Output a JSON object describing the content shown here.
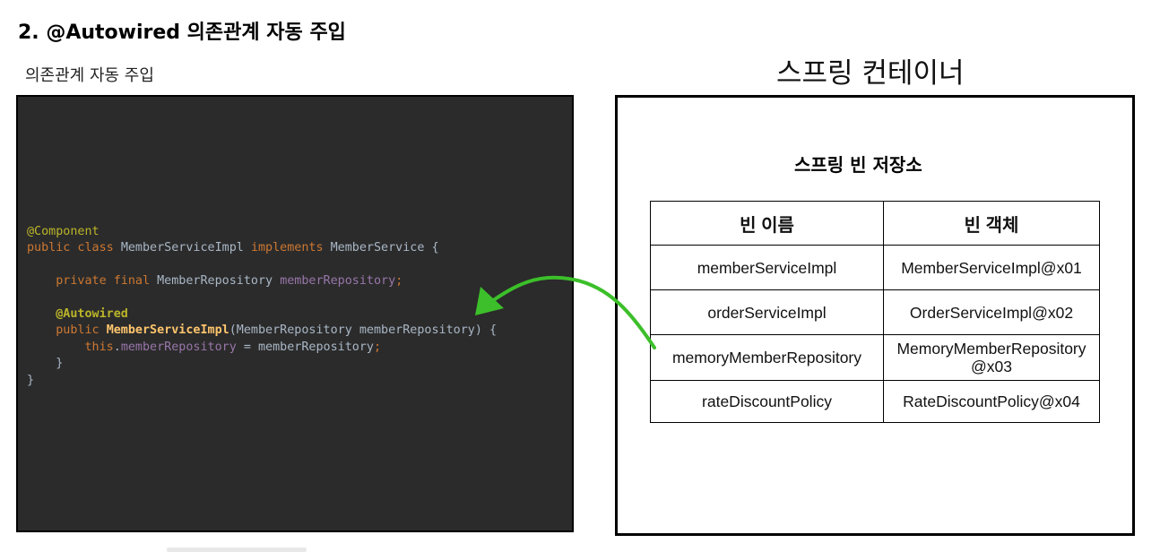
{
  "header": {
    "section_title": "2. @Autowired 의존관계 자동 주입",
    "code_caption": "의존관계 자동 주입",
    "container_title": "스프링 컨테이너"
  },
  "code": {
    "line1": "@Component",
    "line2_kw1": "public class",
    "line2_name": "MemberServiceImpl",
    "line2_kw2": "implements",
    "line2_iface": "MemberService {",
    "line3_kw": "private final",
    "line3_type": "MemberRepository",
    "line3_field": "memberRepository",
    "line3_end": ";",
    "line4": "@Autowired",
    "line5_kw": "public",
    "line5_fn": "MemberServiceImpl",
    "line5_args": "(MemberRepository memberRepository) {",
    "line6_this": "this",
    "line6_dot": ".",
    "line6_field": "memberRepository",
    "line6_rest": " = memberRepository",
    "line6_end": ";",
    "line7": "}",
    "line8": "}"
  },
  "bean_store": {
    "title": "스프링 빈 저장소",
    "headers": [
      "빈 이름",
      "빈 객체"
    ],
    "rows": [
      {
        "name": "memberServiceImpl",
        "object": "MemberServiceImpl@x01",
        "object2": ""
      },
      {
        "name": "orderServiceImpl",
        "object": "OrderServiceImpl@x02",
        "object2": ""
      },
      {
        "name": "memoryMemberRepository",
        "object": "MemoryMemberRepository",
        "object2": "@x03"
      },
      {
        "name": "rateDiscountPolicy",
        "object": "RateDiscountPolicy@x04",
        "object2": ""
      }
    ]
  },
  "colors": {
    "arrow": "#3cbf2a",
    "code_bg": "#2b2b2b",
    "keyword": "#cc7832",
    "annotation": "#bbb529",
    "method": "#ffc66d",
    "field": "#9876aa",
    "plain": "#a9b7c6"
  }
}
